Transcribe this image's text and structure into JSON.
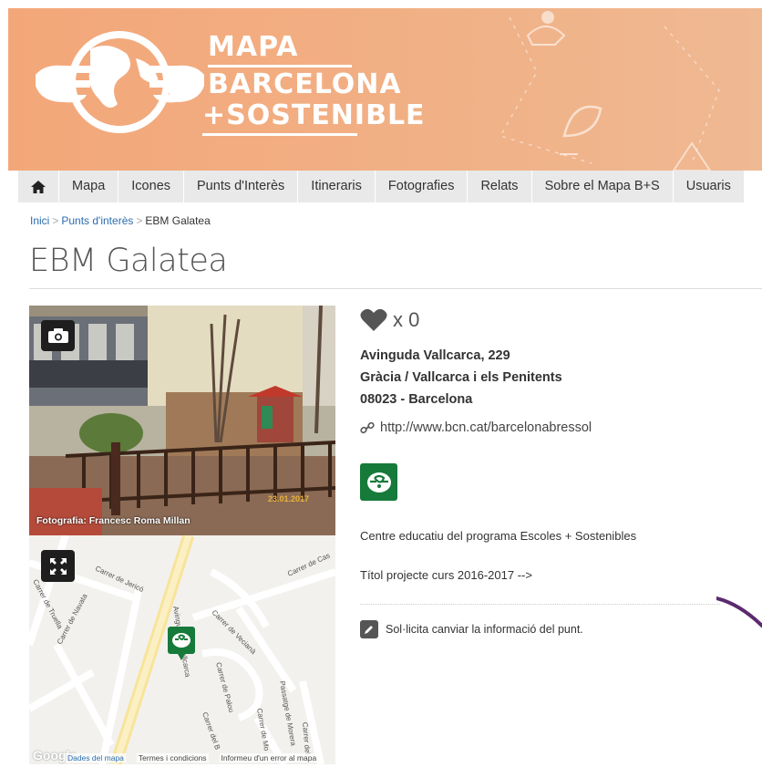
{
  "header": {
    "logo_line1": "MAPA",
    "logo_line2": "BARCELONA",
    "logo_line3": "+SOSTENIBLE"
  },
  "nav": {
    "home_icon": "home-icon",
    "items": [
      "Mapa",
      "Icones",
      "Punts d'Interès",
      "Itineraris",
      "Fotografies",
      "Relats",
      "Sobre el Mapa B+S",
      "Usuaris"
    ]
  },
  "breadcrumb": {
    "items": [
      "Inici",
      "Punts d'interès",
      "EBM Galatea"
    ],
    "separator": ">"
  },
  "page_title": "EBM Galatea",
  "photo": {
    "credit": "Fotografia: Francesc Roma Millan",
    "date_stamp": "23.01.2017"
  },
  "map": {
    "streets": [
      "Carrer de Jericó",
      "Carrer de Truella",
      "Carrer de Navata",
      "Carrer de Cas",
      "Avinguda de Vallcarca",
      "Carrer de Vecianà",
      "Carrer de Palou",
      "Passatge de Morera",
      "Carrer de Mo",
      "Carrer del",
      "Carrer del B"
    ],
    "footer": [
      "Dades del mapa",
      "Termes i condicions",
      "Informeu d'un error al mapa"
    ],
    "google": "Google"
  },
  "info": {
    "likes": "x 0",
    "address_line1": "Avinguda Vallcarca, 229",
    "address_line2": "Gràcia / Vallcarca i els Penitents",
    "address_line3": "08023 - Barcelona",
    "website": "http://www.bcn.cat/barcelonabressol",
    "description": "Centre educatiu del programa Escoles + Sostenibles",
    "project": "Títol projecte curs 2016-2017 -->",
    "request_change": "Sol·licita canviar la informació del punt."
  },
  "colors": {
    "banner": "#f3a779",
    "nav_bg": "#e9e9e9",
    "badge": "#167a3a",
    "link": "#2a6db0"
  }
}
